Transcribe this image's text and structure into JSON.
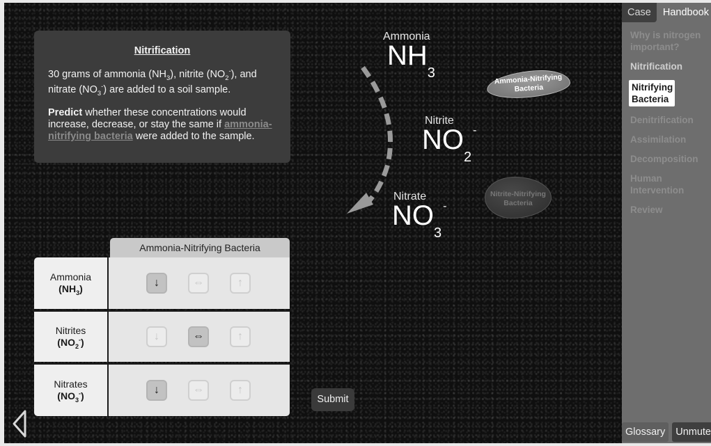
{
  "info_card": {
    "title": "Nitrification",
    "para1_parts": [
      "30 grams of ammonia (NH",
      "3",
      "), nitrite (NO",
      "2",
      "-",
      "), and nitrate (NO",
      "3",
      "-",
      ") are added to a soil sample."
    ],
    "predict_bold": "Predict",
    "predict_text": " whether these concentrations would increase, decrease, or stay the same if ",
    "predict_link": "ammonia-nitrifying bacteria",
    "predict_end": " were added to the sample."
  },
  "cycle": {
    "ammonia": {
      "label": "Ammonia",
      "formula": "NH",
      "sub": "3",
      "sup": ""
    },
    "nitrite": {
      "label": "Nitrite",
      "formula": "NO",
      "sub": "2",
      "sup": "-"
    },
    "nitrate": {
      "label": "Nitrate",
      "formula": "NO",
      "sub": "3",
      "sup": "-"
    }
  },
  "bacteria": [
    {
      "label": "Ammonia-Nitrifying Bacteria",
      "state": "active"
    },
    {
      "label": "Nitrite-Nitrifying Bacteria",
      "state": "inactive"
    }
  ],
  "prediction_table": {
    "column_header": "Ammonia-Nitrifying Bacteria",
    "options": [
      "decrease",
      "stay-same",
      "increase"
    ],
    "rows": [
      {
        "name": "Ammonia",
        "formula": "NH",
        "sub": "3",
        "sup": "",
        "selected": "decrease"
      },
      {
        "name": "Nitrites",
        "formula": "NO",
        "sub": "2",
        "sup": "-",
        "selected": "stay-same"
      },
      {
        "name": "Nitrates",
        "formula": "NO",
        "sub": "3",
        "sup": "-",
        "selected": "decrease"
      }
    ]
  },
  "submit_label": "Submit",
  "sidebar": {
    "tabs": [
      {
        "label": "Case",
        "active": false
      },
      {
        "label": "Handbook",
        "active": true
      }
    ],
    "items": [
      {
        "label": "Why is nitrogen important?",
        "state": "locked"
      },
      {
        "label": "Nitrification",
        "state": "visited"
      },
      {
        "label": "Nitrifying Bacteria",
        "state": "active"
      },
      {
        "label": "Denitrification",
        "state": "locked"
      },
      {
        "label": "Assimilation",
        "state": "locked"
      },
      {
        "label": "Decomposition",
        "state": "locked"
      },
      {
        "label": "Human Intervention",
        "state": "locked"
      },
      {
        "label": "Review",
        "state": "locked"
      }
    ],
    "glossary_label": "Glossary",
    "unmute_label": "Unmute"
  },
  "icons": {
    "decrease": "↓",
    "stay-same": "⇔",
    "increase": "↑"
  }
}
